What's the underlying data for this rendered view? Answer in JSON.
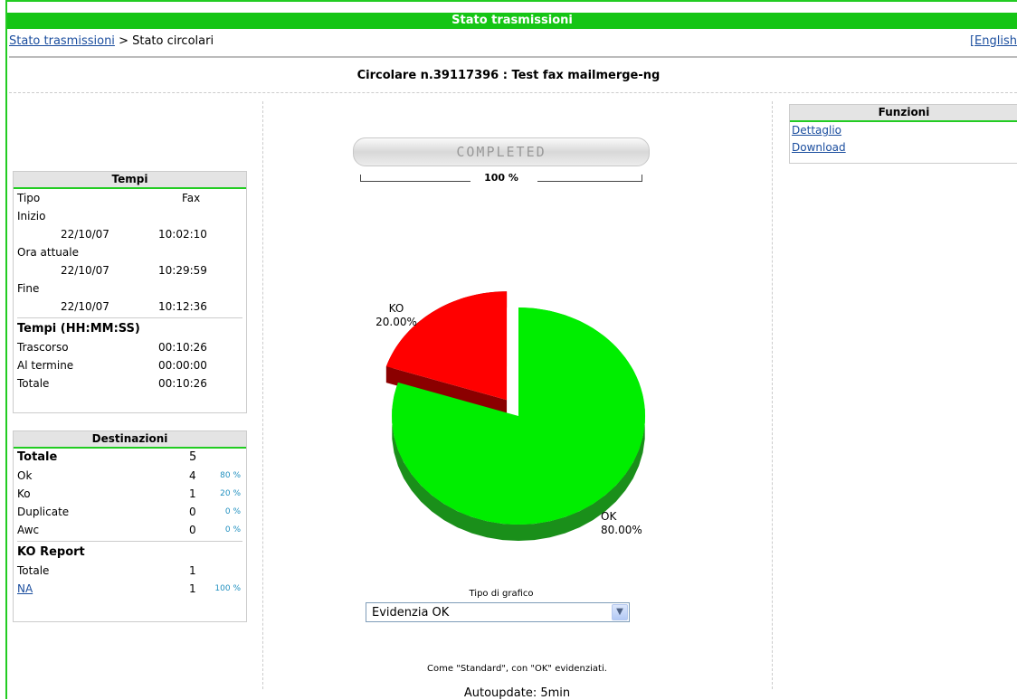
{
  "header": {
    "title": "Stato trasmissioni"
  },
  "breadcrumb": {
    "link": "Stato trasmissioni",
    "separator": ">",
    "current": "Stato circolari"
  },
  "language_link": "[English",
  "circolare_title": "Circolare n.39117396 : Test fax mailmerge-ng",
  "tempi": {
    "title": "Tempi",
    "tipo_label": "Tipo",
    "tipo_value": "Fax",
    "inizio_label": "Inizio",
    "inizio_date": "22/10/07",
    "inizio_time": "10:02:10",
    "ora_label": "Ora attuale",
    "ora_date": "22/10/07",
    "ora_time": "10:29:59",
    "fine_label": "Fine",
    "fine_date": "22/10/07",
    "fine_time": "10:12:36",
    "durations_title": "Tempi (HH:MM:SS)",
    "trascorso_label": "Trascorso",
    "trascorso_value": "00:10:26",
    "altermine_label": "Al termine",
    "altermine_value": "00:00:00",
    "totale_label": "Totale",
    "totale_value": "00:10:26"
  },
  "destinazioni": {
    "title": "Destinazioni",
    "totale_label": "Totale",
    "totale_value": "5",
    "rows": [
      {
        "label": "Ok",
        "count": "4",
        "pct": "80 %"
      },
      {
        "label": "Ko",
        "count": "1",
        "pct": "20 %"
      },
      {
        "label": "Duplicate",
        "count": "0",
        "pct": "0 %"
      },
      {
        "label": "Awc",
        "count": "0",
        "pct": "0 %"
      }
    ],
    "ko_report_title": "KO Report",
    "ko_totale_label": "Totale",
    "ko_totale_value": "1",
    "na_label": "NA",
    "na_count": "1",
    "na_pct": "100 %"
  },
  "funzioni": {
    "title": "Funzioni",
    "links": [
      "Dettaglio",
      "Download"
    ]
  },
  "progress": {
    "status": "COMPLETED",
    "percent_label": "100 %",
    "percent": 100
  },
  "chart_data": {
    "type": "pie",
    "slices": [
      {
        "label": "OK",
        "value": 80.0,
        "value_label": "80.00%",
        "color": "#00ee00",
        "side_color": "#1a8f1a"
      },
      {
        "label": "KO",
        "value": 20.0,
        "value_label": "20.00%",
        "color": "#ff0000",
        "side_color": "#8b0000"
      }
    ],
    "exploded": "KO"
  },
  "chart_type_selector": {
    "label": "Tipo di grafico",
    "selected": "Evidenzia OK",
    "description": "Come \"Standard\", con \"OK\" evidenziati."
  },
  "autoupdate": "Autoupdate: 5min",
  "colors": {
    "accent": "#15c515",
    "link": "#1a4d9e",
    "percent": "#1f8fbf"
  }
}
